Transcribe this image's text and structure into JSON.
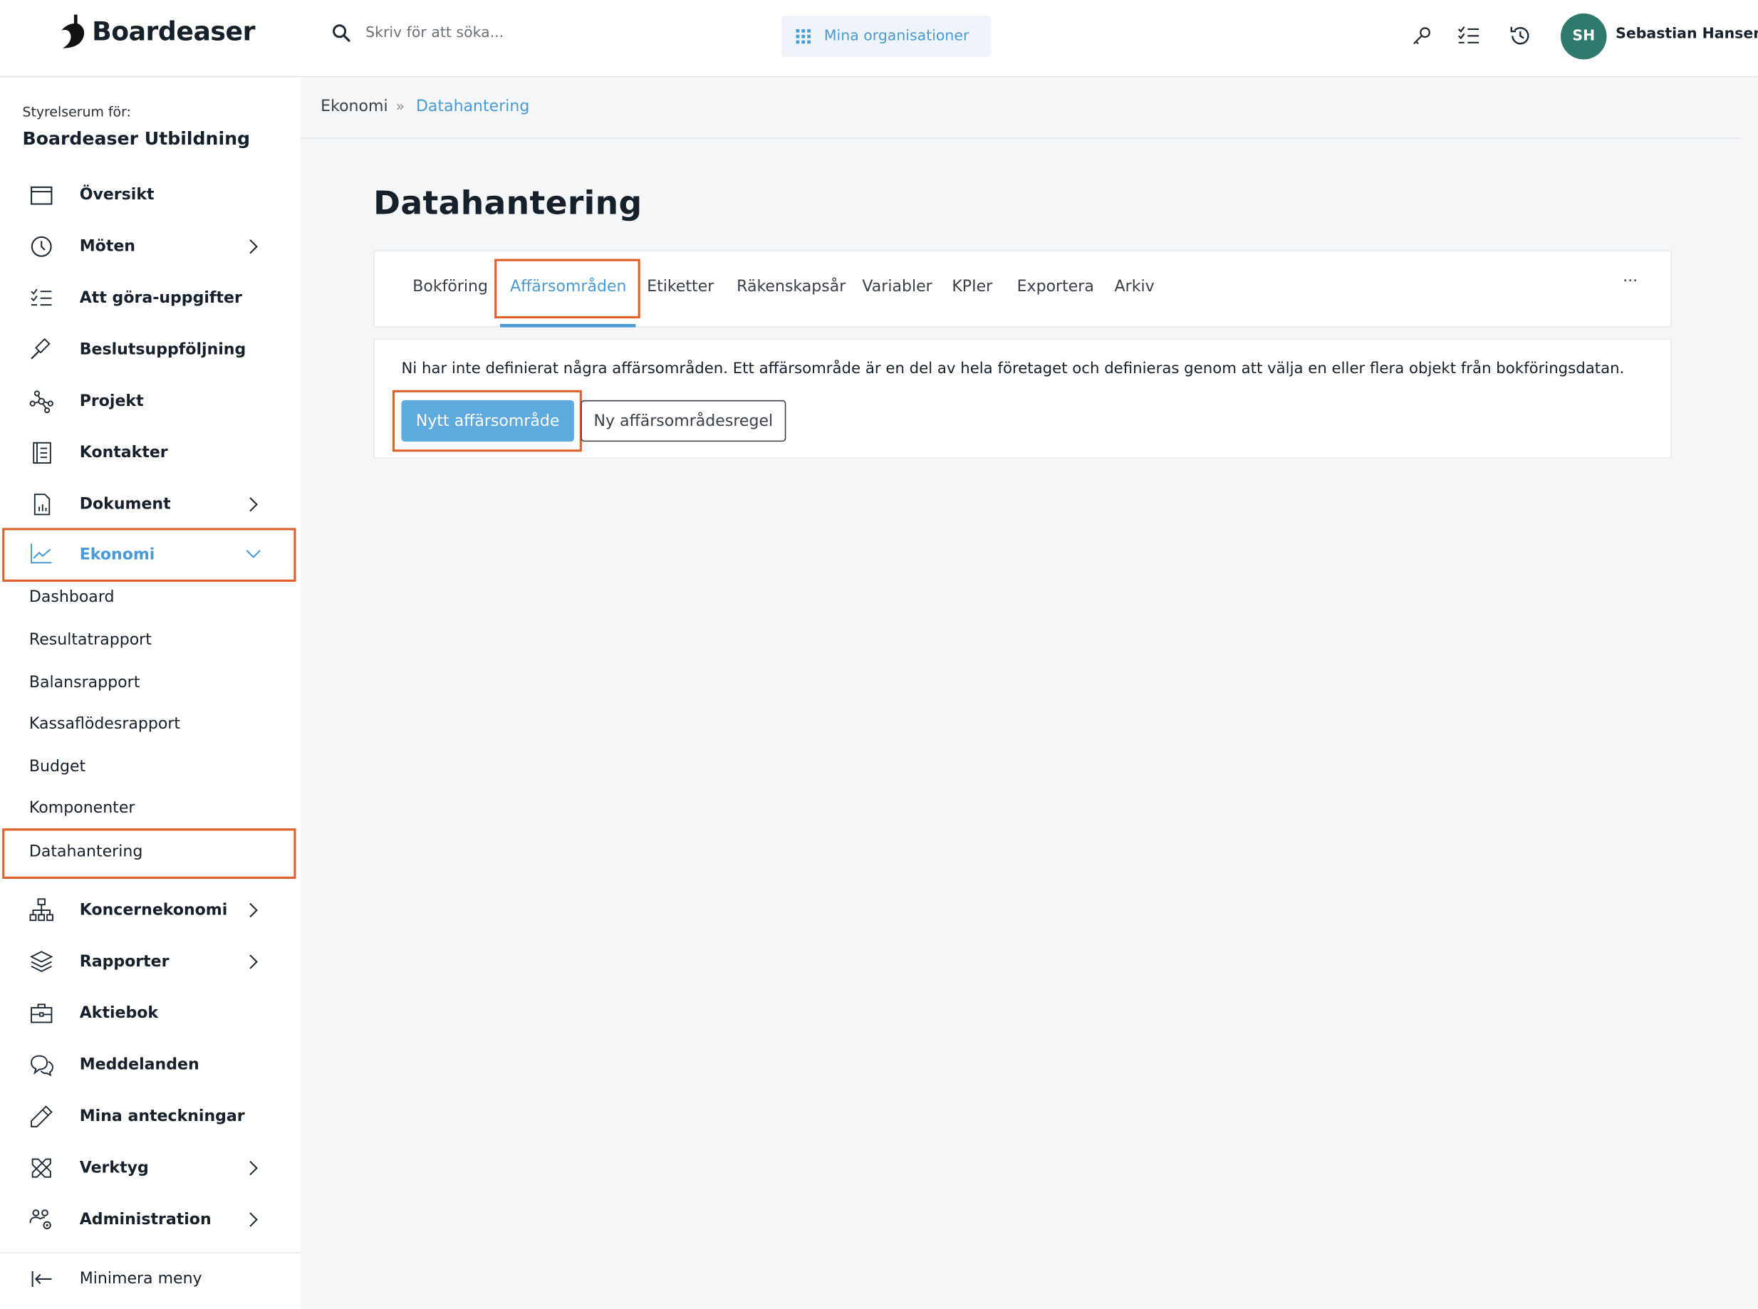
{
  "header": {
    "logo_text": "Boardeaser",
    "search_placeholder": "Skriv för att söka...",
    "org_button_label": "Mina organisationer",
    "user_initials": "SH",
    "user_name": "Sebastian Hansen"
  },
  "sidebar": {
    "org_label": "Styrelserum för:",
    "org_name": "Boardeaser Utbildning",
    "items": [
      {
        "label": "Översikt"
      },
      {
        "label": "Möten"
      },
      {
        "label": "Att göra-uppgifter"
      },
      {
        "label": "Beslutsuppföljning"
      },
      {
        "label": "Projekt"
      },
      {
        "label": "Kontakter"
      },
      {
        "label": "Dokument"
      },
      {
        "label": "Ekonomi"
      },
      {
        "label": "Koncernekonomi"
      },
      {
        "label": "Rapporter"
      },
      {
        "label": "Aktiebok"
      },
      {
        "label": "Meddelanden"
      },
      {
        "label": "Mina anteckningar"
      },
      {
        "label": "Verktyg"
      },
      {
        "label": "Administration"
      }
    ],
    "ekonomi_sub": [
      {
        "label": "Dashboard"
      },
      {
        "label": "Resultatrapport"
      },
      {
        "label": "Balansrapport"
      },
      {
        "label": "Kassaflödesrapport"
      },
      {
        "label": "Budget"
      },
      {
        "label": "Komponenter"
      },
      {
        "label": "Datahantering"
      }
    ],
    "minimize_label": "Minimera meny"
  },
  "breadcrumb": {
    "parent": "Ekonomi",
    "separator": "»",
    "current": "Datahantering"
  },
  "page": {
    "title": "Datahantering",
    "tabs": [
      {
        "label": "Bokföring"
      },
      {
        "label": "Affärsområden"
      },
      {
        "label": "Etiketter"
      },
      {
        "label": "Räkenskapsår"
      },
      {
        "label": "Variabler"
      },
      {
        "label": "KPIer"
      },
      {
        "label": "Exportera"
      },
      {
        "label": "Arkiv"
      }
    ],
    "more_label": "···",
    "info_text": "Ni har inte definierat några affärsområden. Ett affärsområde är en del av hela företaget och definieras genom att välja en eller flera objekt från bokföringsdatan.",
    "primary_button": "Nytt affärsområde",
    "secondary_button": "Ny affärsområdesregel"
  },
  "colors": {
    "accent": "#4a9bd5",
    "highlight": "#e0622a",
    "avatar_bg": "#2f7a6c"
  }
}
